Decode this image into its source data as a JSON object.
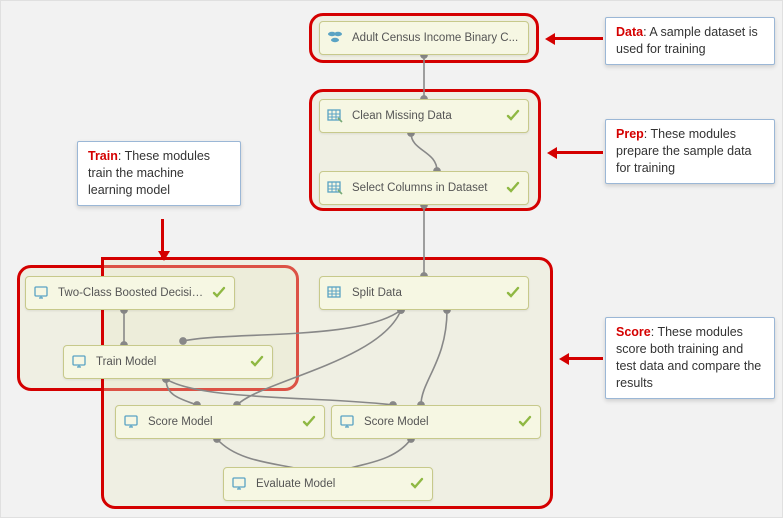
{
  "modules": {
    "dataset": {
      "label": "Adult Census Income Binary C...",
      "icon": "dataset-icon"
    },
    "clean": {
      "label": "Clean Missing Data",
      "icon": "grid-icon"
    },
    "selectcols": {
      "label": "Select Columns in Dataset",
      "icon": "grid-icon"
    },
    "twoclass": {
      "label": "Two-Class Boosted Decision T...",
      "icon": "experiment-icon"
    },
    "trainmodel": {
      "label": "Train Model",
      "icon": "experiment-icon"
    },
    "splitdata": {
      "label": "Split Data",
      "icon": "grid-icon"
    },
    "score1": {
      "label": "Score Model",
      "icon": "experiment-icon"
    },
    "score2": {
      "label": "Score Model",
      "icon": "experiment-icon"
    },
    "evaluate": {
      "label": "Evaluate Model",
      "icon": "experiment-icon"
    }
  },
  "callouts": {
    "data": {
      "title": "Data",
      "text": ": A sample dataset is used for training"
    },
    "prep": {
      "title": "Prep",
      "text": ": These modules prepare the sample data for training"
    },
    "train": {
      "title": "Train",
      "text": ": These modules train the machine learning model"
    },
    "score": {
      "title": "Score",
      "text": ": These modules score both training and test data and compare the results"
    }
  },
  "colors": {
    "callout_border": "#9bb7d6",
    "highlight_border": "#d40000",
    "module_bg": "#f6f7e3",
    "module_border": "#c7c98b",
    "canvas_bg": "#f2f2f2",
    "check": "#8fb843"
  }
}
